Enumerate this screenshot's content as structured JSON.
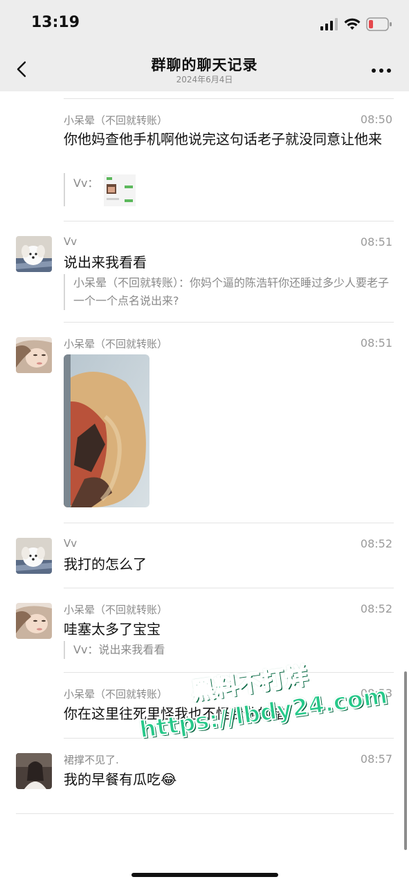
{
  "status_bar": {
    "time": "13:19"
  },
  "nav": {
    "title": "群聊的聊天记录",
    "subtitle": "2024年6月4日"
  },
  "messages": [
    {
      "sender": "小呆晕（不回就转账）",
      "time": "08:50",
      "text": "你他妈查他手机啊他说完这句话老子就没同意让他来",
      "quote_sender": "Vv："
    },
    {
      "sender": "Vv",
      "time": "08:51",
      "text": "说出来我看看",
      "quote": "小呆晕（不回就转账）：你妈个逼的陈浩轩你还睡过多少人要老子一个一个点名说出来?"
    },
    {
      "sender": "小呆晕（不回就转账）",
      "time": "08:51"
    },
    {
      "sender": "Vv",
      "time": "08:52",
      "text": "我打的怎么了"
    },
    {
      "sender": "小呆晕（不回就转账）",
      "time": "08:52",
      "text": "哇塞太多了宝宝",
      "quote": "Vv：说出来我看看"
    },
    {
      "sender": "小呆晕（不回就转账）",
      "time": "08:53",
      "text": "你在这里往死里怪我也不怪我他的错"
    },
    {
      "sender": "裙撑不见了.",
      "time": "08:57",
      "text": "我的早餐有瓜吃😂"
    }
  ],
  "watermark": {
    "line1": "黑料不打烊",
    "line2": "https://lbdy24.com"
  },
  "colors": {
    "bar_bg": "#ededed",
    "watermark": "#27c98a",
    "battery_low": "#e5484d"
  }
}
